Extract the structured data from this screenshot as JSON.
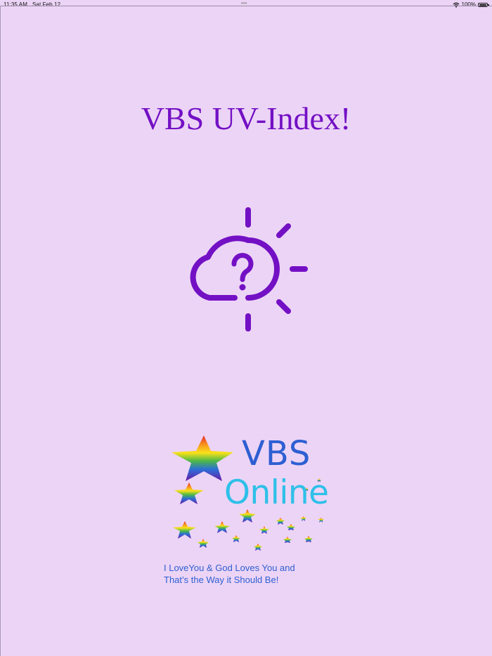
{
  "status_bar": {
    "time": "11:35 AM",
    "date": "Sat Feb 12",
    "center_dots": "•••",
    "battery_percent": "100%",
    "battery_level": 1.0
  },
  "app": {
    "title": "VBS UV-Index!"
  },
  "weather_icon": {
    "name": "cloud-sun-question-icon",
    "color": "#7310c4"
  },
  "logo": {
    "line1": "VBS",
    "line2": "Online",
    "line1_color": "#2d5fd2",
    "line2_color": "#2ec0e8"
  },
  "tagline": {
    "line1": "I LoveYou & God Loves You and",
    "line2": "That’s the Way it Should Be!"
  },
  "colors": {
    "background": "#ecd4f6",
    "accent": "#7310c4"
  }
}
